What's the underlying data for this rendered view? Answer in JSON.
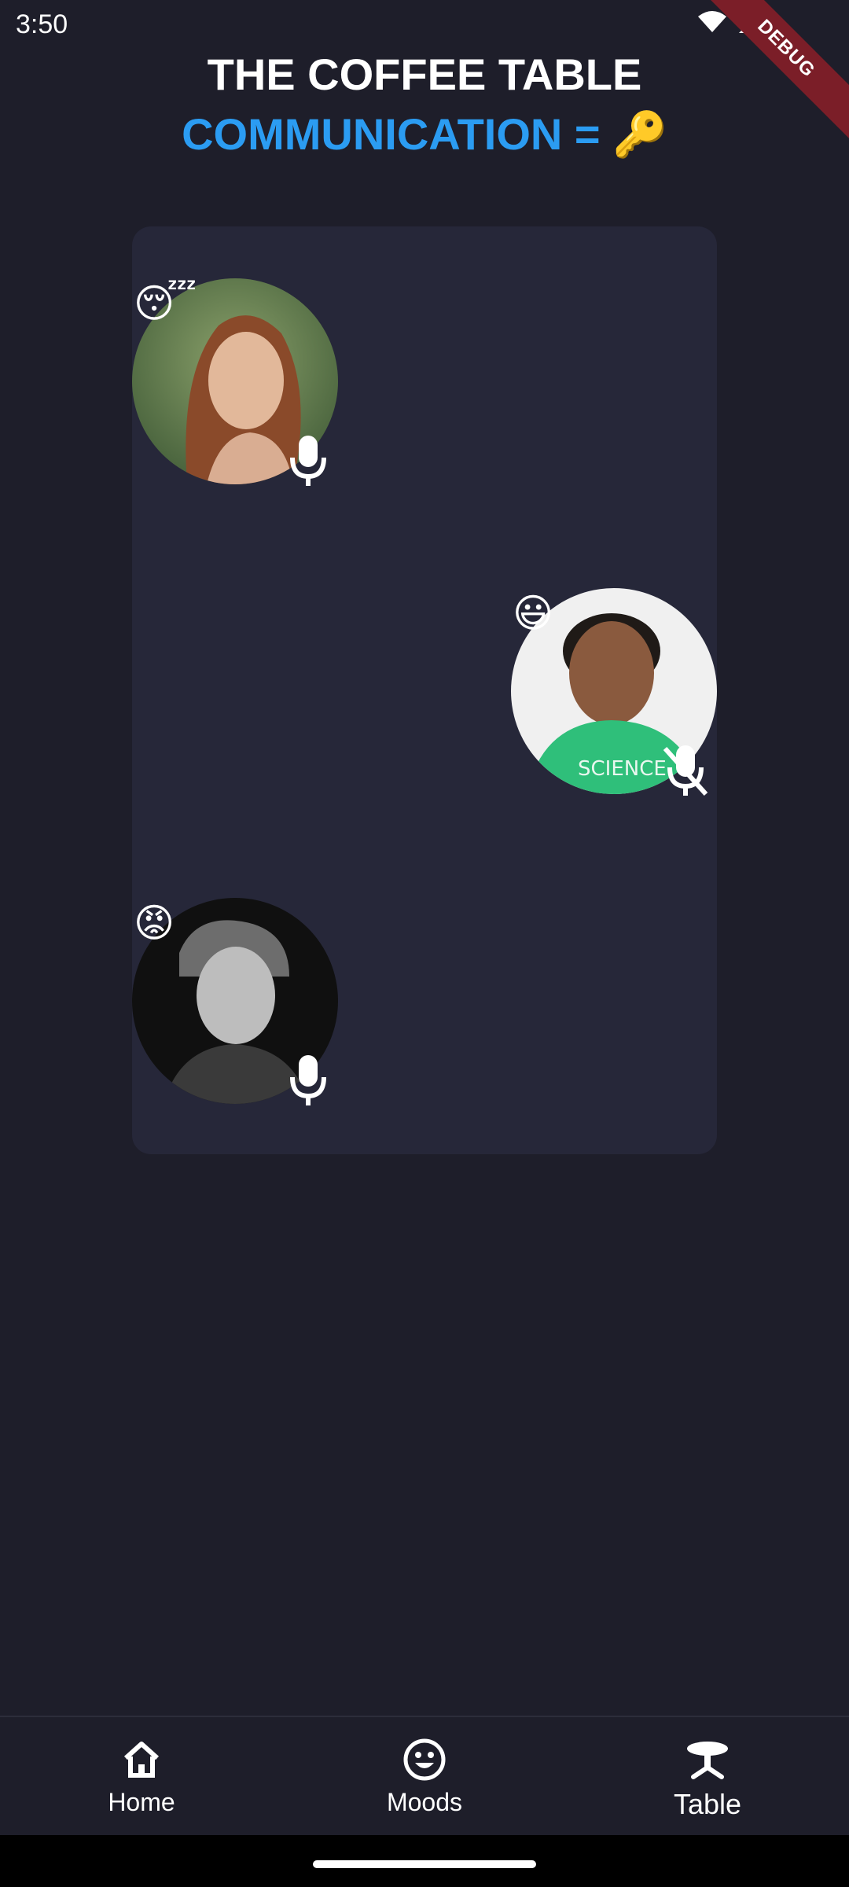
{
  "status_bar": {
    "time": "3:50",
    "debug_label": "DEBUG"
  },
  "header": {
    "title": "THE COFFEE TABLE",
    "subtitle": "COMMUNICATION = 🔑"
  },
  "participants": [
    {
      "mood_emoji": "😴",
      "mic": "mic-on"
    },
    {
      "mood_emoji": "😃",
      "mic": "mic-off"
    },
    {
      "mood_emoji": "😡",
      "mic": "mic-on"
    }
  ],
  "bottom_nav": {
    "items": [
      {
        "label": "Home",
        "icon": "home-icon"
      },
      {
        "label": "Moods",
        "icon": "smiley-icon"
      },
      {
        "label": "Table",
        "icon": "table-icon",
        "active": true
      }
    ]
  },
  "colors": {
    "background": "#1e1e2a",
    "card": "#262739",
    "accent": "#2b9cf2"
  }
}
